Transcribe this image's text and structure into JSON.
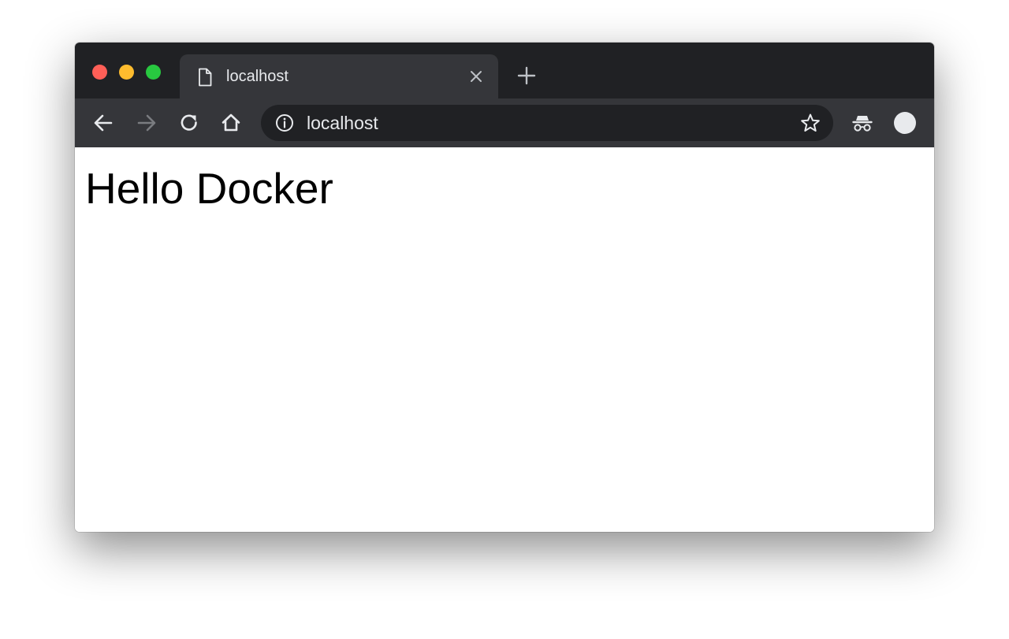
{
  "window": {
    "traffic_lights": {
      "close_color": "#ff5f57",
      "minimize_color": "#febc2e",
      "maximize_color": "#28c840"
    }
  },
  "tab": {
    "title": "localhost",
    "icon": "document-icon",
    "close_icon": "close-icon"
  },
  "new_tab": {
    "icon": "plus-icon"
  },
  "toolbar": {
    "back_icon": "arrow-left-icon",
    "forward_icon": "arrow-right-icon",
    "reload_icon": "reload-icon",
    "home_icon": "home-icon"
  },
  "omnibox": {
    "info_icon": "info-icon",
    "url": "localhost",
    "bookmark_icon": "star-icon"
  },
  "extras": {
    "incognito_icon": "incognito-icon",
    "profile_icon": "avatar"
  },
  "page": {
    "heading": "Hello Docker"
  },
  "colors": {
    "tabstrip_bg": "#202124",
    "toolbar_bg": "#35363a",
    "omnibox_bg": "#202124",
    "text_light": "#e8eaed",
    "page_bg": "#ffffff"
  }
}
